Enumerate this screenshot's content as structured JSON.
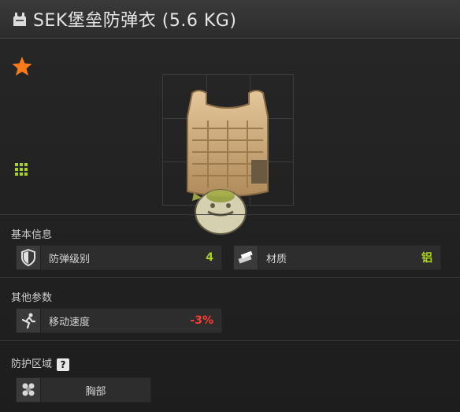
{
  "header": {
    "title": "SEK堡垒防弹衣 (5.6 KG)",
    "icon": "vest-icon"
  },
  "item": {
    "favorite_icon": "star-icon",
    "grid_icon": "grid-icon",
    "image": "body-armor-vest"
  },
  "sections": {
    "basic": {
      "label": "基本信息",
      "stats": [
        {
          "label": "防弹级别",
          "value": "4",
          "icon": "shield-icon"
        },
        {
          "label": "材质",
          "value": "铝",
          "icon": "material-icon"
        }
      ]
    },
    "other": {
      "label": "其他参数",
      "stats": [
        {
          "label": "移动速度",
          "value": "-3%",
          "icon": "running-icon"
        }
      ]
    },
    "protection": {
      "label": "防护区域",
      "help_label": "?",
      "zones": [
        {
          "label": "胸部",
          "icon": "body-zone-icon"
        }
      ]
    }
  },
  "colors": {
    "accent_green": "#a8d41a",
    "negative_red": "#ff3b2f",
    "star_orange": "#ff7a1a"
  }
}
